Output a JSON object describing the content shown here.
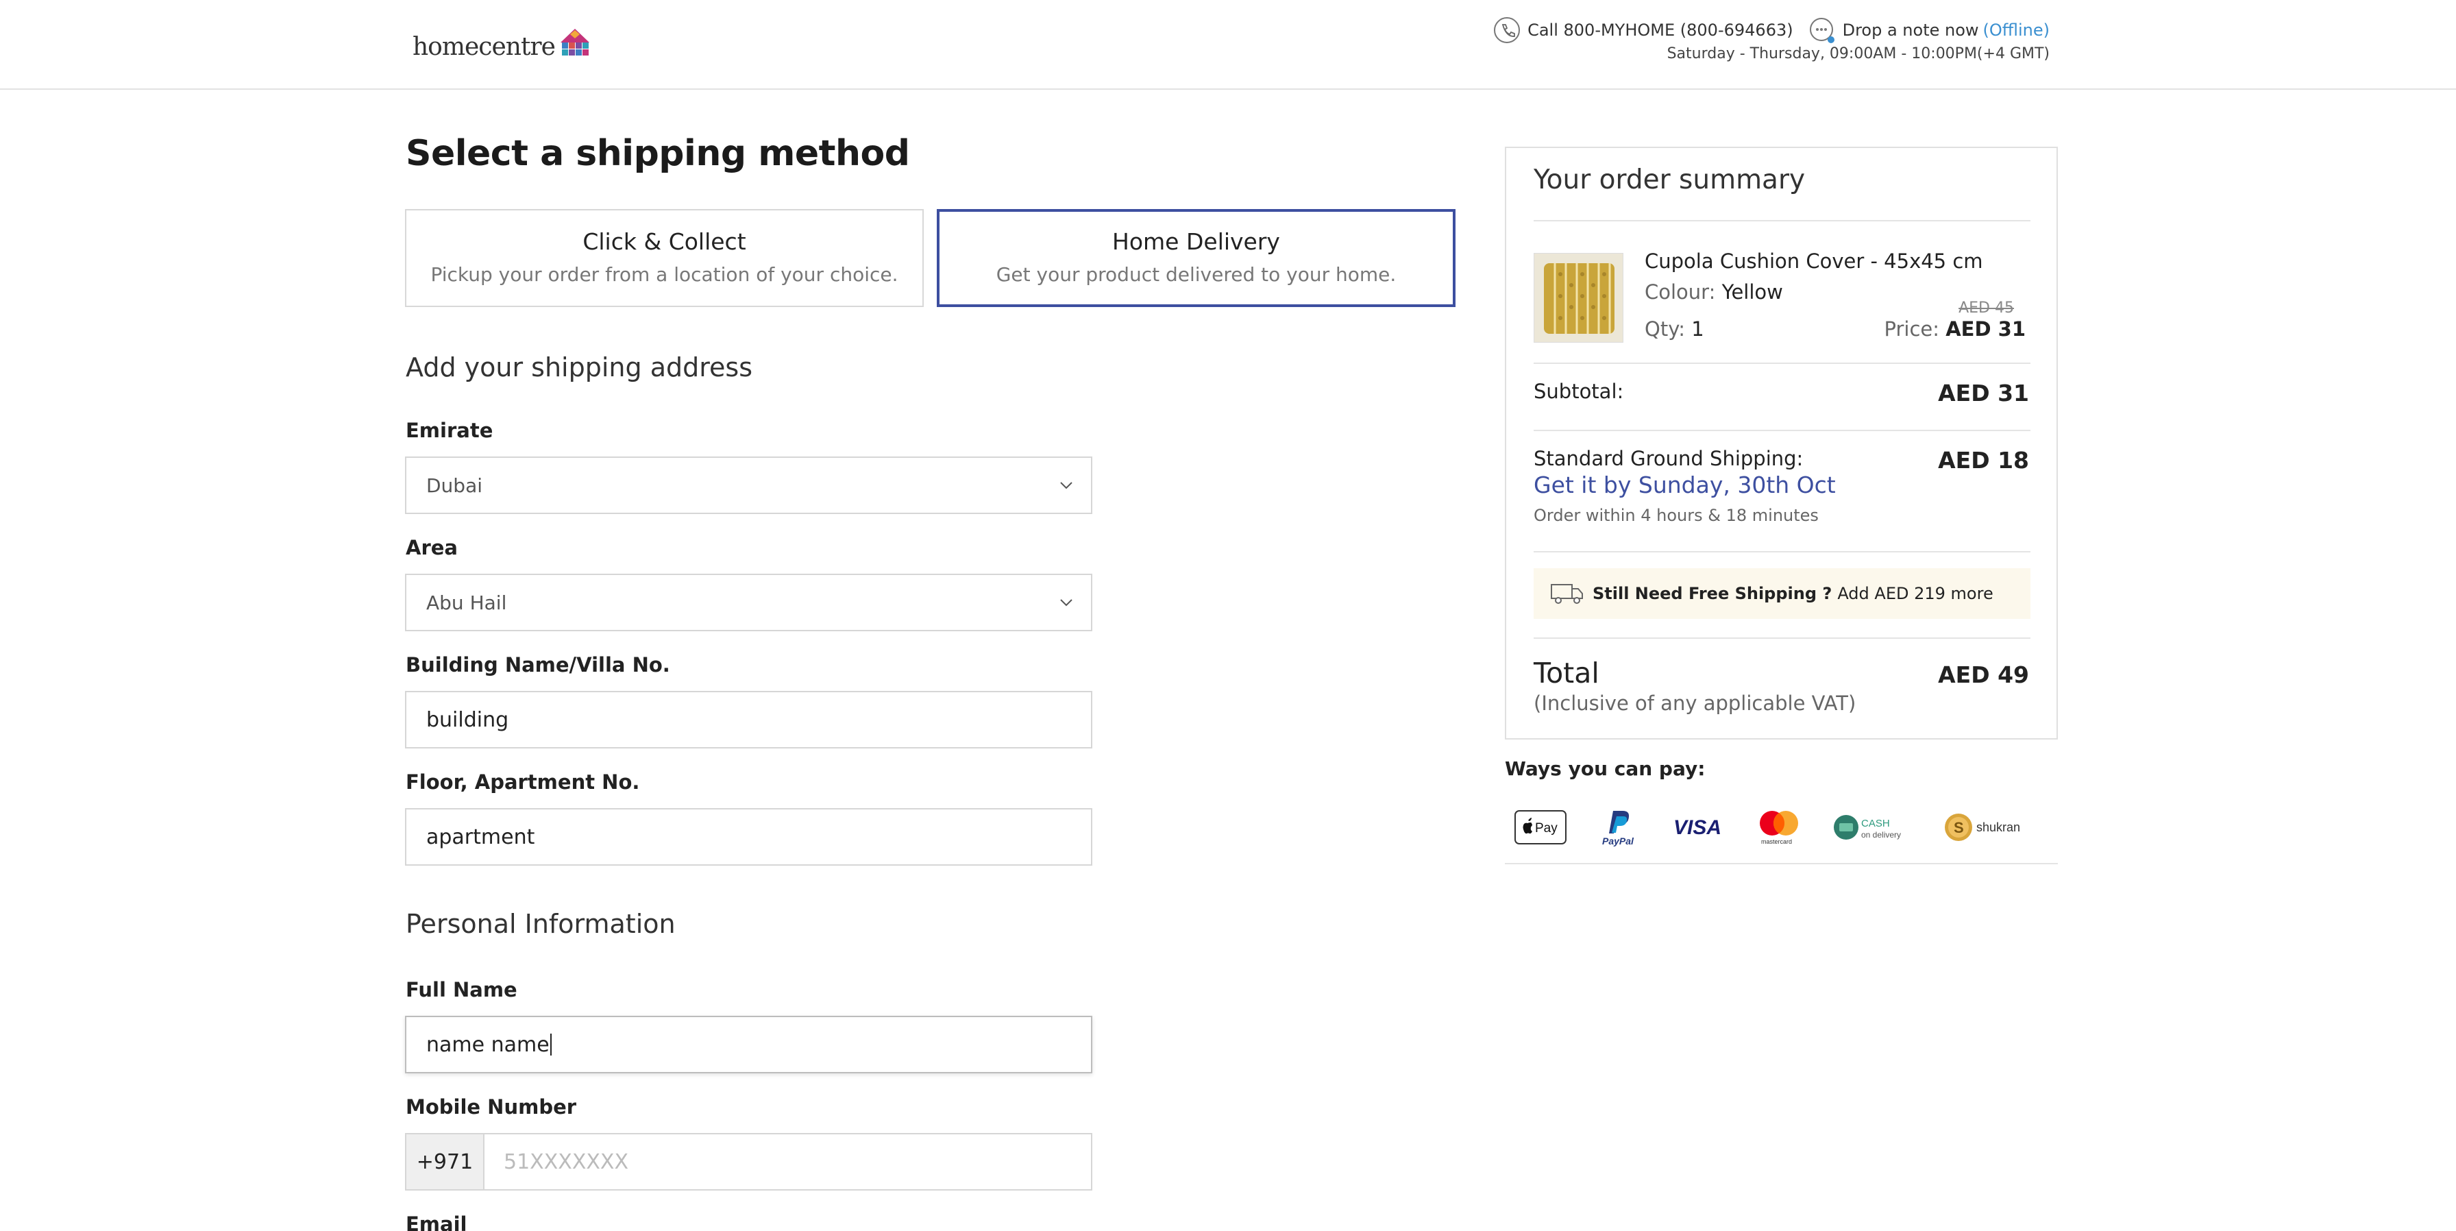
{
  "header": {
    "logo_text": "homecentre",
    "call_text": "Call 800-MYHOME (800-694663)",
    "note_text": "Drop a note now",
    "offline_text": "(Offline)",
    "hours_text": "Saturday - Thursday, 09:00AM - 10:00PM(+4 GMT)"
  },
  "shipping": {
    "title": "Select a shipping method",
    "methods": [
      {
        "title": "Click & Collect",
        "subtitle": "Pickup your order from a location of your choice."
      },
      {
        "title": "Home Delivery",
        "subtitle": "Get your product delivered to your home."
      }
    ],
    "selected": "Home Delivery"
  },
  "address": {
    "title": "Add your shipping address",
    "emirate_label": "Emirate",
    "emirate_value": "Dubai",
    "area_label": "Area",
    "area_value": "Abu Hail",
    "building_label": "Building Name/Villa No.",
    "building_value": "building",
    "floor_label": "Floor, Apartment No.",
    "floor_value": "apartment"
  },
  "personal": {
    "title": "Personal Information",
    "name_label": "Full Name",
    "name_value": "name name",
    "mobile_label": "Mobile Number",
    "mobile_prefix": "+971",
    "mobile_placeholder": "51XXXXXXX",
    "email_label": "Email"
  },
  "summary": {
    "title": "Your order summary",
    "product": {
      "name": "Cupola Cushion Cover - 45x45 cm",
      "colour_label": "Colour:",
      "colour_value": "Yellow",
      "qty_label": "Qty:",
      "qty_value": "1",
      "old_price": "AED 45",
      "price_label": "Price:",
      "price_value": "AED 31"
    },
    "subtotal_label": "Subtotal:",
    "subtotal_value": "AED 31",
    "shipping_label": "Standard Ground Shipping:",
    "shipping_value": "AED 18",
    "eta": "Get it by Sunday, 30th Oct",
    "order_within": "Order within 4 hours & 18 minutes",
    "free_ship_bold": "Still Need Free Shipping ?",
    "free_ship_text": "Add AED 219 more",
    "total_label": "Total",
    "vat_text": "(Inclusive of any applicable VAT)",
    "total_value": "AED 49"
  },
  "payment": {
    "title": "Ways you can pay:",
    "methods": [
      "Apple Pay",
      "PayPal",
      "VISA",
      "Mastercard",
      "Cash on delivery",
      "Shukran"
    ],
    "applepay_text": "Pay",
    "paypal_text": "PayPal",
    "visa_text": "VISA",
    "mastercard_text": "mastercard",
    "cash_text": "CASH",
    "cash_sub": "on delivery",
    "shukran_text": "shukran"
  },
  "colors": {
    "accent": "#3d4fa0",
    "link": "#3a8fd0",
    "free_ship_bg": "#fcf8ec"
  },
  "icons": [
    "phone-icon",
    "chat-icon",
    "chevron-down-icon",
    "truck-icon"
  ]
}
